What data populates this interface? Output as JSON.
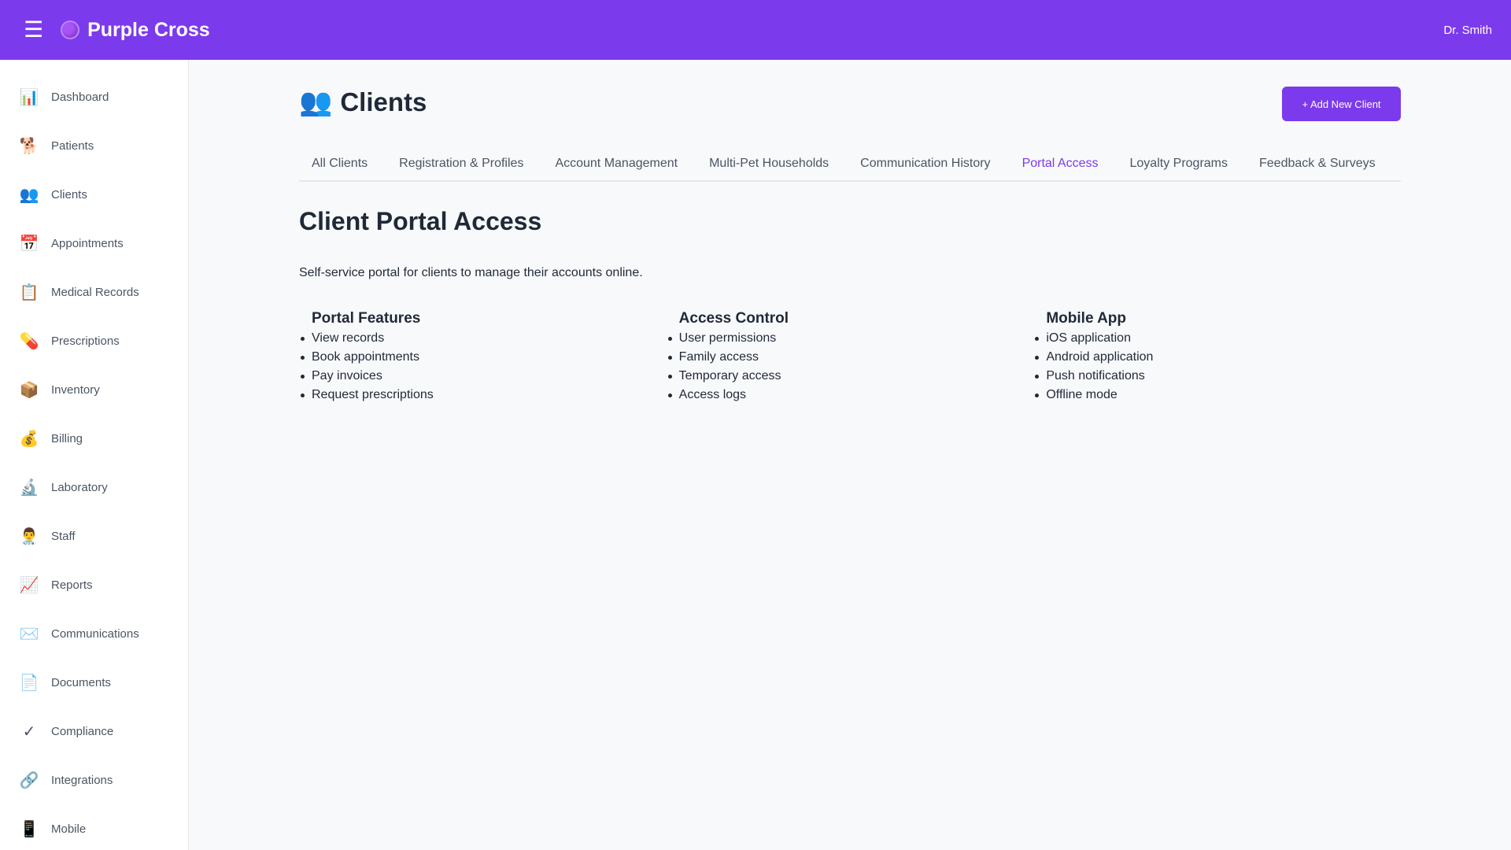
{
  "topbar": {
    "menu_icon": "hamburger-icon",
    "brand_icon": "purple-circle-icon",
    "brand": "Purple Cross",
    "user": "Dr. Smith",
    "accent": "#7c3aed"
  },
  "sidebar": {
    "items": [
      {
        "icon": "📊",
        "icon_name": "bar-chart-icon",
        "label": "Dashboard"
      },
      {
        "icon": "🐕",
        "icon_name": "dog-icon",
        "label": "Patients"
      },
      {
        "icon": "👥",
        "icon_name": "people-icon",
        "label": "Clients"
      },
      {
        "icon": "📅",
        "icon_name": "calendar-icon",
        "label": "Appointments"
      },
      {
        "icon": "📋",
        "icon_name": "clipboard-icon",
        "label": "Medical Records"
      },
      {
        "icon": "💊",
        "icon_name": "pill-icon",
        "label": "Prescriptions"
      },
      {
        "icon": "📦",
        "icon_name": "package-icon",
        "label": "Inventory"
      },
      {
        "icon": "💰",
        "icon_name": "money-bag-icon",
        "label": "Billing"
      },
      {
        "icon": "🔬",
        "icon_name": "microscope-icon",
        "label": "Laboratory"
      },
      {
        "icon": "👨‍⚕️",
        "icon_name": "doctor-icon",
        "label": "Staff"
      },
      {
        "icon": "📈",
        "icon_name": "trend-chart-icon",
        "label": "Reports"
      },
      {
        "icon": "✉️",
        "icon_name": "envelope-icon",
        "label": "Communications"
      },
      {
        "icon": "📄",
        "icon_name": "document-icon",
        "label": "Documents"
      },
      {
        "icon": "✓",
        "icon_name": "checkmark-icon",
        "label": "Compliance"
      },
      {
        "icon": "🔗",
        "icon_name": "link-icon",
        "label": "Integrations"
      },
      {
        "icon": "📱",
        "icon_name": "mobile-phone-icon",
        "label": "Mobile"
      }
    ]
  },
  "page": {
    "title_icon": "👥",
    "title": "Clients",
    "add_button": "+ Add New Client"
  },
  "tabs": [
    {
      "label": "All Clients",
      "active": false
    },
    {
      "label": "Registration & Profiles",
      "active": false
    },
    {
      "label": "Account Management",
      "active": false
    },
    {
      "label": "Multi-Pet Households",
      "active": false
    },
    {
      "label": "Communication History",
      "active": false
    },
    {
      "label": "Portal Access",
      "active": true
    },
    {
      "label": "Loyalty Programs",
      "active": false
    },
    {
      "label": "Feedback & Surveys",
      "active": false
    }
  ],
  "section": {
    "title": "Client Portal Access",
    "description": "Self-service portal for clients to manage their accounts online.",
    "columns": [
      {
        "heading": "Portal Features",
        "items": [
          "View records",
          "Book appointments",
          "Pay invoices",
          "Request prescriptions"
        ]
      },
      {
        "heading": "Access Control",
        "items": [
          "User permissions",
          "Family access",
          "Temporary access",
          "Access logs"
        ]
      },
      {
        "heading": "Mobile App",
        "items": [
          "iOS application",
          "Android application",
          "Push notifications",
          "Offline mode"
        ]
      }
    ]
  }
}
